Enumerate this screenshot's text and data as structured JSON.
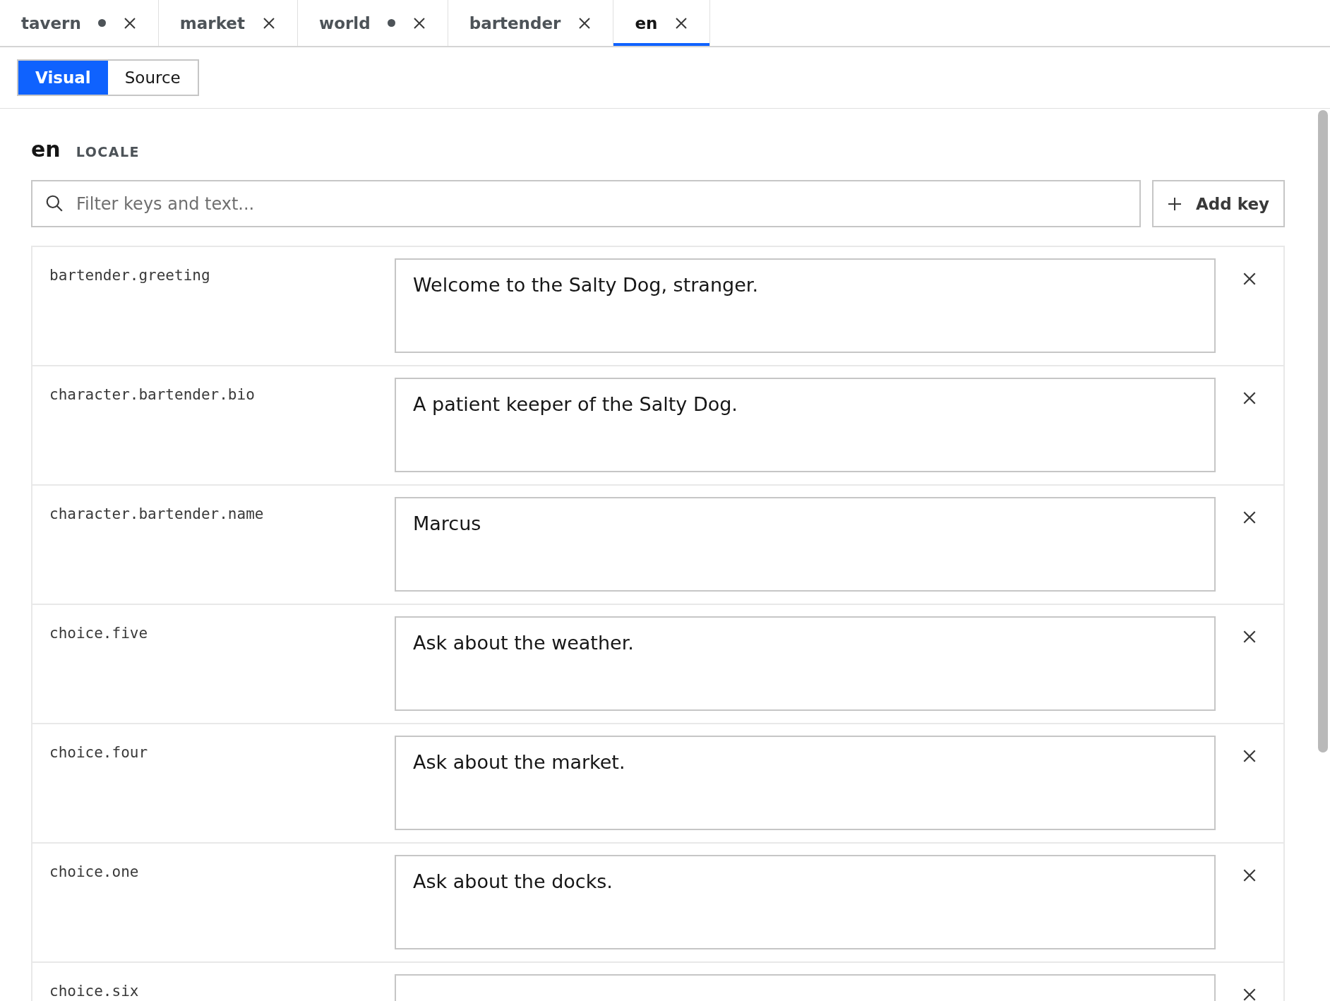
{
  "tabs": [
    {
      "label": "tavern",
      "modified": true,
      "selected": false
    },
    {
      "label": "market",
      "modified": false,
      "selected": false
    },
    {
      "label": "world",
      "modified": true,
      "selected": false
    },
    {
      "label": "bartender",
      "modified": false,
      "selected": false
    },
    {
      "label": "en",
      "modified": false,
      "selected": true
    }
  ],
  "view_modes": [
    {
      "label": "Visual",
      "selected": true
    },
    {
      "label": "Source",
      "selected": false
    }
  ],
  "heading": {
    "title": "en",
    "subtitle": "LOCALE"
  },
  "search": {
    "placeholder": "Filter keys and text..."
  },
  "add_button": "Add key",
  "entries": [
    {
      "key": "bartender.greeting",
      "value": "Welcome to the Salty Dog, stranger."
    },
    {
      "key": "character.bartender.bio",
      "value": "A patient keeper of the Salty Dog."
    },
    {
      "key": "character.bartender.name",
      "value": "Marcus"
    },
    {
      "key": "choice.five",
      "value": "Ask about the weather."
    },
    {
      "key": "choice.four",
      "value": "Ask about the market."
    },
    {
      "key": "choice.one",
      "value": "Ask about the docks."
    },
    {
      "key": "choice.six"
    }
  ]
}
